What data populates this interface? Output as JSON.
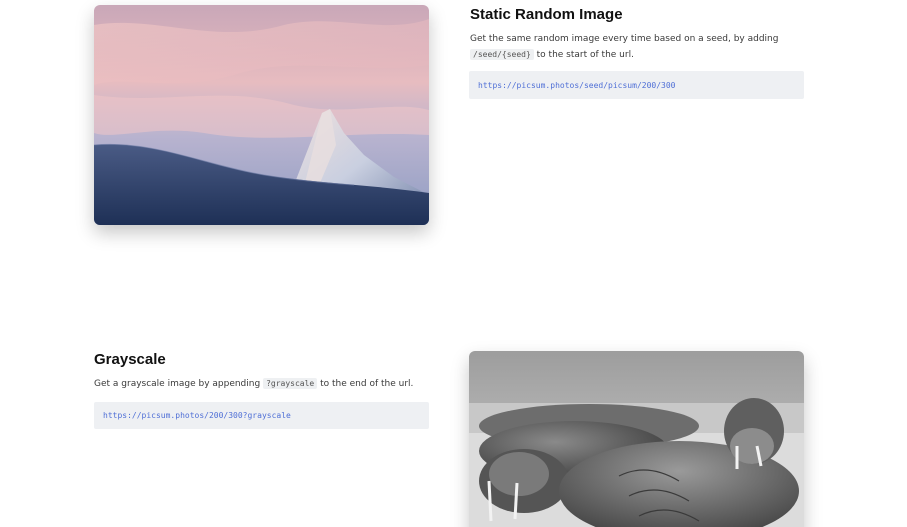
{
  "static_section": {
    "title": "Static Random Image",
    "desc_before": "Get the same random image every time based on a seed, by adding",
    "code": "/seed/{seed}",
    "desc_after": " to the start of the url.",
    "url": "https://picsum.photos/seed/picsum/200/300",
    "image_subject": "mountain-peak-at-sunset"
  },
  "grayscale_section": {
    "title": "Grayscale",
    "desc_before": "Get a grayscale image by appending",
    "code": "?grayscale",
    "desc_after": " to the end of the url.",
    "url": "https://picsum.photos/200/300?grayscale",
    "image_subject": "walruses-on-beach"
  },
  "colors": {
    "link": "#4f6fd6",
    "code_bg": "#eef0f3",
    "title": "#111111"
  }
}
